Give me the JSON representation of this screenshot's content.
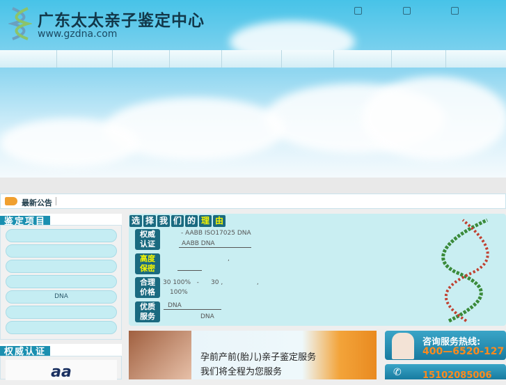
{
  "header": {
    "site_title": "广东太太亲子鉴定中心",
    "site_url": "www.gzdna.com",
    "top_icons": [
      "home-icon",
      "bookmark-icon",
      "contact-icon"
    ]
  },
  "nav": {
    "item_count": 9
  },
  "notice": {
    "label": "最新公告"
  },
  "sidebar": {
    "projects_title": "鉴定项目",
    "project_items": [
      "",
      "",
      "",
      "",
      "DNA",
      "",
      ""
    ],
    "cert_title": "权威认证",
    "cert_logo": "aa"
  },
  "why": {
    "title_chars": [
      "选",
      "择",
      "我",
      "们",
      "的",
      "理",
      "由"
    ],
    "rows": [
      {
        "badge": [
          "权威",
          "认证"
        ],
        "line1": "- AABB  ISO17025     DNA",
        "line2": "AABB DNA"
      },
      {
        "badge": [
          "高度",
          "保密"
        ],
        "line1": ",",
        "line2": ""
      },
      {
        "badge": [
          "合理",
          "价格"
        ],
        "line1": "30 100%   -      30 ,                 ,",
        "line2": "100%"
      },
      {
        "badge": [
          "优质",
          "服务"
        ],
        "line1": "DNA",
        "line2": "DNA"
      }
    ]
  },
  "banner": {
    "line1": "孕前产前(胎儿)亲子鉴定服务",
    "line2": "我们将全程为您服务"
  },
  "hotline": {
    "label": "咨询服务热线:",
    "number": "400—6520-127",
    "mobile": "15102085006"
  },
  "colors": {
    "accent": "#1b8fb0",
    "badge": "#1a6a80",
    "highlight": "#f5f500",
    "hot_number": "#ff8a1c"
  }
}
